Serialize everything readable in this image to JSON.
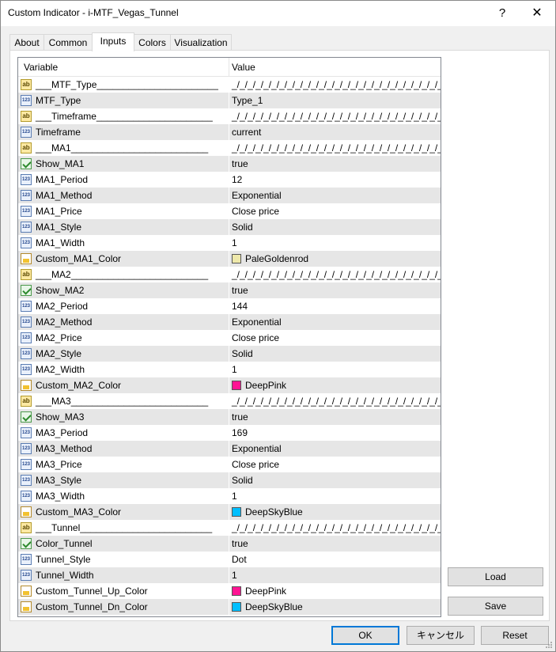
{
  "window": {
    "title": "Custom Indicator - i-MTF_Vegas_Tunnel",
    "help_label": "?",
    "close_label": "✕"
  },
  "tabs": [
    {
      "label": "About"
    },
    {
      "label": "Common"
    },
    {
      "label": "Inputs",
      "active": true
    },
    {
      "label": "Colors"
    },
    {
      "label": "Visualization"
    }
  ],
  "grid": {
    "col_variable": "Variable",
    "col_value": "Value",
    "rows": [
      {
        "icon": "ab",
        "name": "___MTF_Type_______________________",
        "value": "_/_/_/_/_/_/_/_/_/_/_/_/_/_/_/_/_/_/_/_/_/_/_/_/_/_/_/_/_/..."
      },
      {
        "icon": "num",
        "name": "MTF_Type",
        "value": "Type_1"
      },
      {
        "icon": "ab",
        "name": "___Timeframe______________________",
        "value": "_/_/_/_/_/_/_/_/_/_/_/_/_/_/_/_/_/_/_/_/_/_/_/_/_/_/_/_/_/..."
      },
      {
        "icon": "num",
        "name": "Timeframe",
        "value": "current"
      },
      {
        "icon": "ab",
        "name": "___MA1__________________________",
        "value": "_/_/_/_/_/_/_/_/_/_/_/_/_/_/_/_/_/_/_/_/_/_/_/_/_/_/_/_/_/..."
      },
      {
        "icon": "bool",
        "name": "Show_MA1",
        "value": "true"
      },
      {
        "icon": "num",
        "name": "MA1_Period",
        "value": "12"
      },
      {
        "icon": "num",
        "name": "MA1_Method",
        "value": "Exponential"
      },
      {
        "icon": "num",
        "name": "MA1_Price",
        "value": "Close price"
      },
      {
        "icon": "num",
        "name": "MA1_Style",
        "value": "Solid"
      },
      {
        "icon": "num",
        "name": "MA1_Width",
        "value": "1"
      },
      {
        "icon": "color",
        "name": "Custom_MA1_Color",
        "value": "PaleGoldenrod",
        "swatch": "#eee8aa"
      },
      {
        "icon": "ab",
        "name": "___MA2__________________________",
        "value": "_/_/_/_/_/_/_/_/_/_/_/_/_/_/_/_/_/_/_/_/_/_/_/_/_/_/_/_/_/..."
      },
      {
        "icon": "bool",
        "name": "Show_MA2",
        "value": "true"
      },
      {
        "icon": "num",
        "name": "MA2_Period",
        "value": "144"
      },
      {
        "icon": "num",
        "name": "MA2_Method",
        "value": "Exponential"
      },
      {
        "icon": "num",
        "name": "MA2_Price",
        "value": "Close price"
      },
      {
        "icon": "num",
        "name": "MA2_Style",
        "value": "Solid"
      },
      {
        "icon": "num",
        "name": "MA2_Width",
        "value": "1"
      },
      {
        "icon": "color",
        "name": "Custom_MA2_Color",
        "value": "DeepPink",
        "swatch": "#ff1493"
      },
      {
        "icon": "ab",
        "name": "___MA3__________________________",
        "value": "_/_/_/_/_/_/_/_/_/_/_/_/_/_/_/_/_/_/_/_/_/_/_/_/_/_/_/_/_/..."
      },
      {
        "icon": "bool",
        "name": "Show_MA3",
        "value": "true"
      },
      {
        "icon": "num",
        "name": "MA3_Period",
        "value": "169"
      },
      {
        "icon": "num",
        "name": "MA3_Method",
        "value": "Exponential"
      },
      {
        "icon": "num",
        "name": "MA3_Price",
        "value": "Close price"
      },
      {
        "icon": "num",
        "name": "MA3_Style",
        "value": "Solid"
      },
      {
        "icon": "num",
        "name": "MA3_Width",
        "value": "1"
      },
      {
        "icon": "color",
        "name": "Custom_MA3_Color",
        "value": "DeepSkyBlue",
        "swatch": "#00bfff"
      },
      {
        "icon": "ab",
        "name": "___Tunnel_________________________",
        "value": "_/_/_/_/_/_/_/_/_/_/_/_/_/_/_/_/_/_/_/_/_/_/_/_/_/_/_/_/_/..."
      },
      {
        "icon": "bool",
        "name": "Color_Tunnel",
        "value": "true"
      },
      {
        "icon": "num",
        "name": "Tunnel_Style",
        "value": "Dot"
      },
      {
        "icon": "num",
        "name": "Tunnel_Width",
        "value": "1"
      },
      {
        "icon": "color",
        "name": "Custom_Tunnel_Up_Color",
        "value": "DeepPink",
        "swatch": "#ff1493"
      },
      {
        "icon": "color",
        "name": "Custom_Tunnel_Dn_Color",
        "value": "DeepSkyBlue",
        "swatch": "#00bfff"
      }
    ]
  },
  "side_buttons": {
    "load": "Load",
    "save": "Save"
  },
  "footer_buttons": {
    "ok": "OK",
    "cancel": "キャンセル",
    "reset": "Reset"
  }
}
